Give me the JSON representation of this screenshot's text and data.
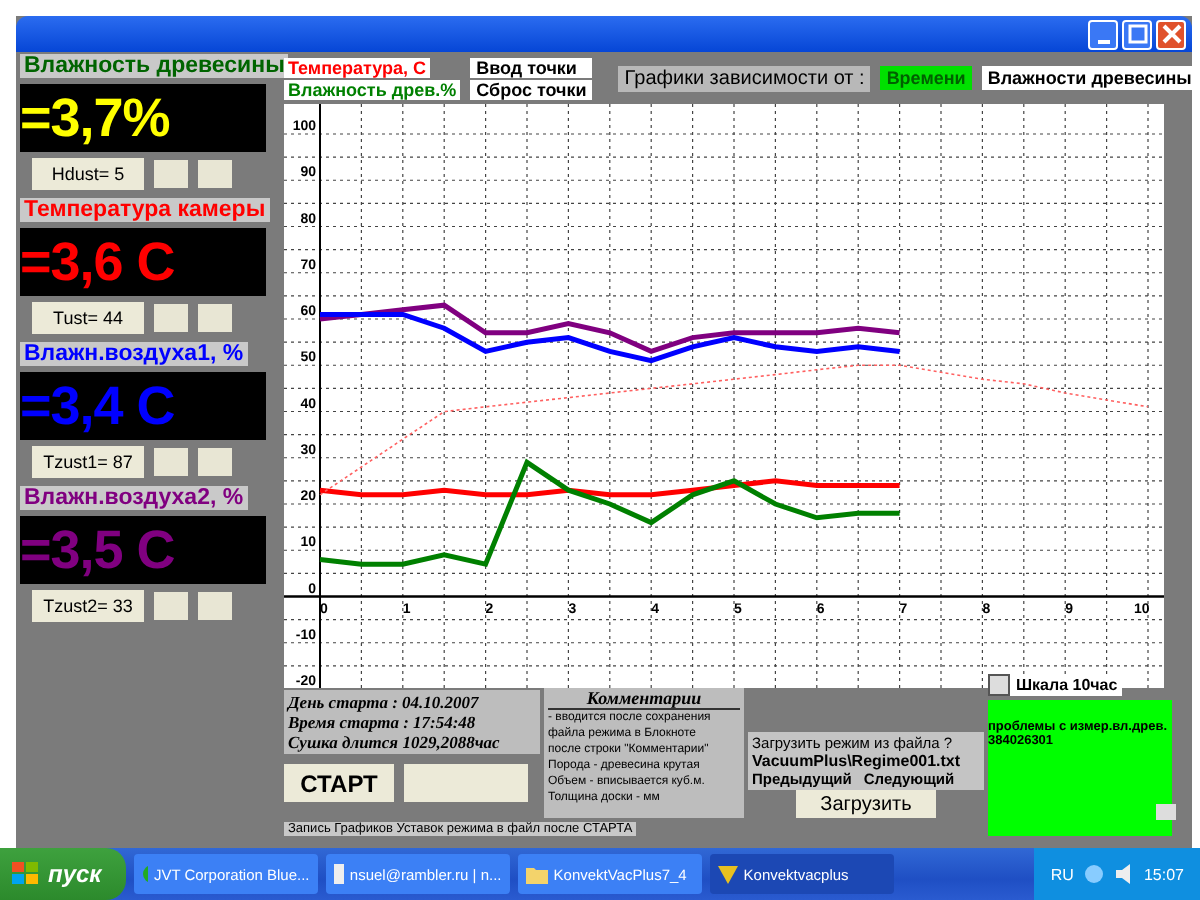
{
  "sensors": [
    {
      "title": "Влажность древесины",
      "value": "=3,7%",
      "color": "#ffff00",
      "setting": "Hdust= 5"
    },
    {
      "title": "Температура камеры",
      "value": "=3,6 C",
      "color": "#ff0000",
      "setting": "Tust= 44"
    },
    {
      "title": "Влажн.воздуха1, %",
      "value": "=3,4 C",
      "color": "#0000ff",
      "setting": "Tzust1= 87"
    },
    {
      "title": "Влажн.воздуха2, %",
      "value": "=3,5 C",
      "color": "#800080",
      "setting": "Tzust2= 33"
    }
  ],
  "legend": [
    {
      "label": "Температура, С",
      "color": "#ff0000"
    },
    {
      "label": "Влажность древ.%",
      "color": "#008000"
    }
  ],
  "point_buttons": [
    "Ввод  точки",
    "Сброс точки"
  ],
  "graph_by": {
    "label": "Графики зависимости от :",
    "options": [
      {
        "label": "Времени",
        "selected": true
      },
      {
        "label": "Влажности древесины",
        "selected": false
      }
    ]
  },
  "chart": {
    "chart_data": {
      "type": "line",
      "x": [
        0,
        0.5,
        1,
        1.5,
        2,
        2.5,
        3,
        3.5,
        4,
        4.5,
        5,
        5.5,
        6,
        6.5,
        7,
        7.5,
        8,
        8.5,
        9,
        9.5,
        10
      ],
      "xlim": [
        0,
        10
      ],
      "ylim": [
        -20,
        100
      ],
      "xticks": [
        0,
        1,
        2,
        3,
        4,
        5,
        6,
        7,
        8,
        9,
        10
      ],
      "yticks": [
        -20,
        -10,
        0,
        10,
        20,
        30,
        40,
        50,
        60,
        70,
        80,
        90,
        100
      ],
      "grid": true,
      "series": [
        {
          "color": "#800080",
          "line_style": "solid",
          "values": [
            60,
            61,
            62,
            63,
            57,
            57,
            59,
            57,
            53,
            56,
            57,
            57,
            57,
            58,
            57,
            null,
            null,
            null,
            null,
            null,
            null
          ]
        },
        {
          "color": "#0000ff",
          "line_style": "solid",
          "values": [
            61,
            61,
            61,
            58,
            53,
            55,
            56,
            53,
            51,
            54,
            56,
            54,
            53,
            54,
            53,
            null,
            null,
            null,
            null,
            null,
            null
          ]
        },
        {
          "color": "#ff0000",
          "line_style": "solid",
          "values": [
            23,
            22,
            22,
            23,
            22,
            22,
            23,
            22,
            22,
            23,
            24,
            25,
            24,
            24,
            24,
            null,
            null,
            null,
            null,
            null,
            null
          ]
        },
        {
          "color": "#008000",
          "line_style": "solid",
          "values": [
            8,
            7,
            7,
            9,
            7,
            29,
            23,
            20,
            16,
            22,
            25,
            20,
            17,
            18,
            18,
            null,
            null,
            null,
            null,
            null,
            null
          ]
        },
        {
          "color": "#ff6060",
          "line_style": "dashed",
          "values": [
            22,
            28,
            34,
            40,
            41,
            42,
            43,
            44,
            45,
            46,
            47,
            48,
            49,
            50,
            50,
            48.5,
            47,
            46,
            44,
            42.5,
            41
          ]
        }
      ]
    }
  },
  "start_info": [
    "День старта : 04.10.2007",
    "Время старта : 17:54:48",
    "Сушка длится 1029,2088час"
  ],
  "start_button": "СТАРТ",
  "comments": {
    "title": "Комментарии",
    "lines": [
      "- вводится после сохранения",
      "файла режима в Блокноте",
      "после строки \"Комментарии\"",
      "Порода - древесина крутая",
      "Объем - вписывается куб.м.",
      "Толщина доски - мм"
    ]
  },
  "status": "Запись Графиков  Уставок режима в файл после СТАРТА",
  "load": {
    "prompt": "Загрузить режим из файла ?",
    "file": "VacuumPlus\\Regime001.txt",
    "prev": "Предыдущий",
    "next": "Следующий",
    "button": "Загрузить"
  },
  "scale": {
    "label": "Шкала 10час",
    "checked": false
  },
  "alert": [
    "проблемы с измер.вл.древ.",
    "384026301"
  ],
  "taskbar": {
    "start": "пуск",
    "tasks": [
      {
        "label": "JVT Corporation Blue...",
        "selected": false
      },
      {
        "label": "nsuel@rambler.ru | n...",
        "selected": false
      },
      {
        "label": "KonvektVacPlus7_4",
        "selected": false
      },
      {
        "label": "Konvektvacplus",
        "selected": true
      }
    ],
    "lang": "RU",
    "clock": "15:07"
  }
}
